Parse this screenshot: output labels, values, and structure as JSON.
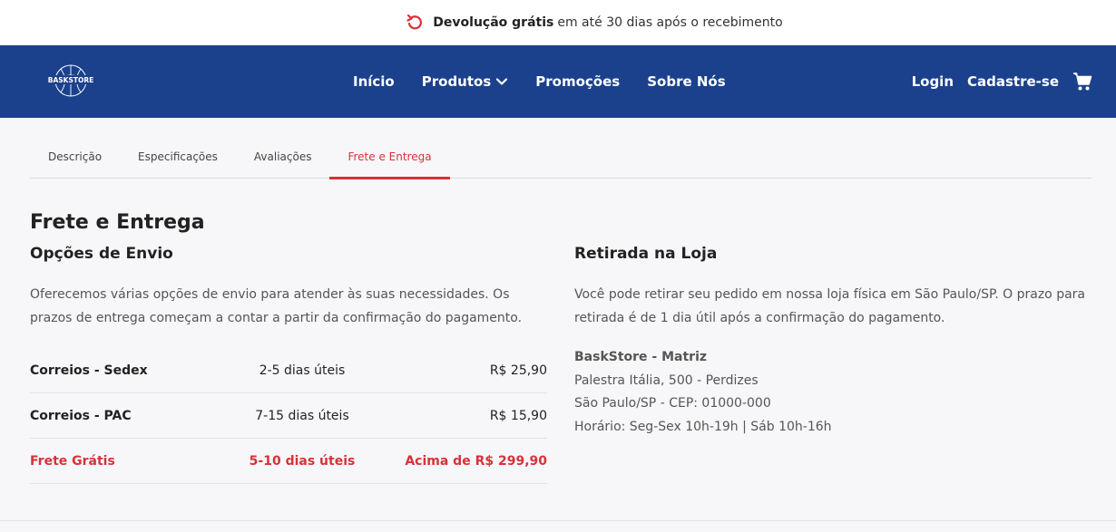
{
  "topbar": {
    "bold": "Devolução grátis",
    "text": "em até 30 dias após o recebimento",
    "icon": "return-arrow-icon"
  },
  "nav": {
    "logo_text": "BASKSTORE",
    "links": [
      "Início",
      "Produtos",
      "Promoções",
      "Sobre Nós"
    ],
    "login": "Login",
    "signup": "Cadastre-se",
    "bg_color": "#1c418c"
  },
  "tabs": [
    "Descrição",
    "Especificações",
    "Avaliações",
    "Frete e Entrega"
  ],
  "active_tab": "Frete e Entrega",
  "accent_color": "#d6323a",
  "section_title": "Frete e Entrega",
  "shipping": {
    "title": "Opções de Envio",
    "description": "Oferecemos várias opções de envio para atender às suas necessidades. Os prazos de entrega começam a contar a partir da confirmação do pagamento.",
    "rows": [
      {
        "method": "Correios - Sedex",
        "time": "2-5 dias úteis",
        "price": "R$ 25,90"
      },
      {
        "method": "Correios - PAC",
        "time": "7-15 dias úteis",
        "price": "R$ 15,90"
      },
      {
        "method": "Frete Grátis",
        "time": "5-10 dias úteis",
        "price": "Acima de R$ 299,90"
      }
    ]
  },
  "pickup": {
    "title": "Retirada na Loja",
    "description": "Você pode retirar seu pedido em nossa loja física em São Paulo/SP. O prazo para retirada é de 1 dia útil após a confirmação do pagamento.",
    "store_name": "BaskStore - Matriz",
    "address": "Palestra Itália, 500 - Perdizes",
    "city": "São Paulo/SP - CEP: 01000-000",
    "hours": "Horário: Seg-Sex 10h-19h | Sáb 10h-16h"
  }
}
